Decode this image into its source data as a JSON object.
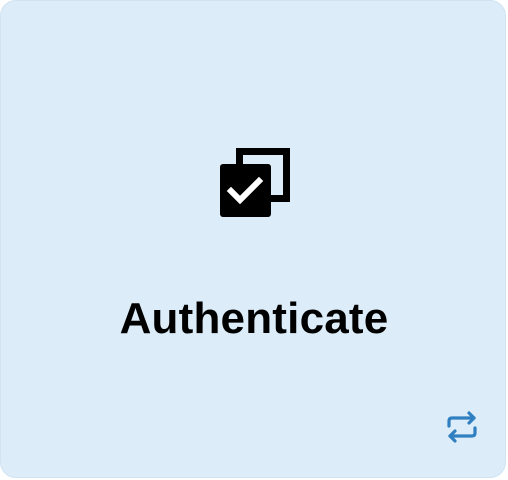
{
  "card": {
    "title": "Authenticate",
    "icon": "check-box-stack-icon",
    "background_color": "#dcedf9"
  },
  "actions": {
    "swap_icon": "swap-arrows-icon",
    "swap_color": "#2f7fc1"
  }
}
